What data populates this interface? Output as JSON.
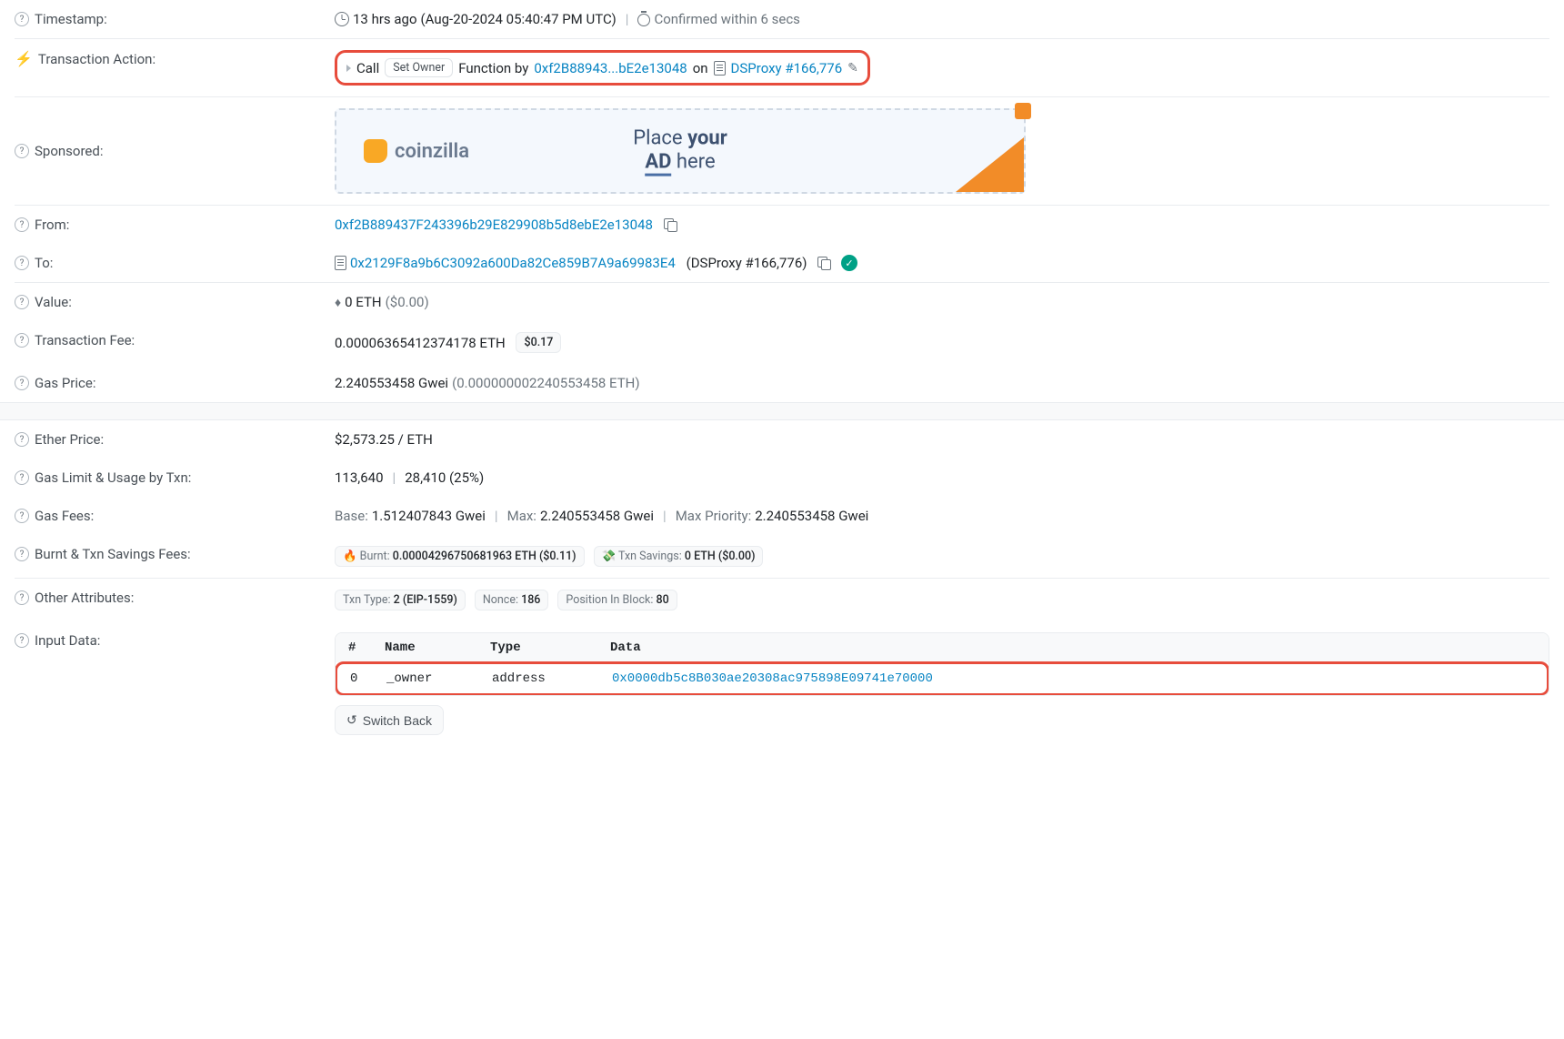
{
  "timestamp": {
    "label": "Timestamp:",
    "ago": "13 hrs ago",
    "full": "(Aug-20-2024 05:40:47 PM UTC)",
    "confirmed": "Confirmed within 6 secs"
  },
  "action": {
    "label": "Transaction Action:",
    "call": "Call",
    "tag": "Set Owner",
    "funcBy": "Function by",
    "fromAddr": "0xf2B88943...bE2e13048",
    "on": "on",
    "target": "DSProxy #166,776"
  },
  "sponsored": {
    "label": "Sponsored:",
    "brand": "coinzilla",
    "line1a": "Place ",
    "line1b": "your",
    "line2a": "AD",
    "line2b": " here"
  },
  "from": {
    "label": "From:",
    "addr": "0xf2B889437F243396b29E829908b5d8ebE2e13048"
  },
  "to": {
    "label": "To:",
    "addr": "0x2129F8a9b6C3092a600Da82Ce859B7A9a69983E4",
    "name": "(DSProxy #166,776)"
  },
  "value": {
    "label": "Value:",
    "eth": "0 ETH",
    "usd": "($0.00)"
  },
  "fee": {
    "label": "Transaction Fee:",
    "eth": "0.00006365412374178 ETH",
    "usd": "$0.17"
  },
  "gasPrice": {
    "label": "Gas Price:",
    "gwei": "2.240553458 Gwei",
    "eth": "(0.000000002240553458 ETH)"
  },
  "etherPrice": {
    "label": "Ether Price:",
    "value": "$2,573.25 / ETH"
  },
  "gasLimit": {
    "label": "Gas Limit & Usage by Txn:",
    "limit": "113,640",
    "usage": "28,410 (25%)"
  },
  "gasFees": {
    "label": "Gas Fees:",
    "baseLabel": "Base:",
    "base": "1.512407843 Gwei",
    "maxLabel": "Max:",
    "max": "2.240553458 Gwei",
    "prioLabel": "Max Priority:",
    "prio": "2.240553458 Gwei"
  },
  "burnt": {
    "label": "Burnt & Txn Savings Fees:",
    "burntLabel": "Burnt:",
    "burntVal": "0.00004296750681963 ETH ($0.11)",
    "savingsLabel": "Txn Savings:",
    "savingsVal": "0 ETH ($0.00)"
  },
  "attrs": {
    "label": "Other Attributes:",
    "txnTypeLabel": "Txn Type:",
    "txnType": "2 (EIP-1559)",
    "nonceLabel": "Nonce:",
    "nonce": "186",
    "posLabel": "Position In Block:",
    "pos": "80"
  },
  "inputData": {
    "label": "Input Data:",
    "head": {
      "idx": "#",
      "name": "Name",
      "type": "Type",
      "data": "Data"
    },
    "row": {
      "idx": "0",
      "name": "_owner",
      "type": "address",
      "data": "0x0000db5c8B030ae20308ac975898E09741e70000"
    },
    "switchBack": "Switch Back"
  }
}
